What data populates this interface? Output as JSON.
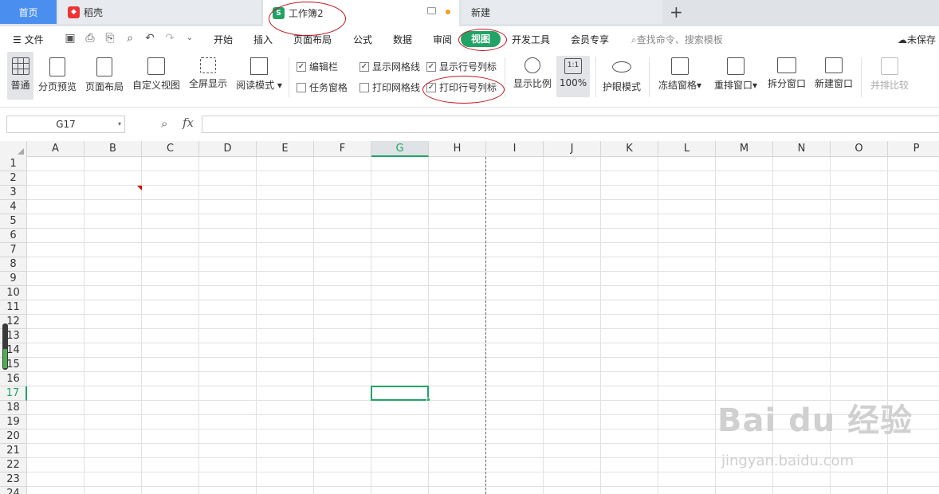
{
  "tabs": {
    "home": "首页",
    "daoke": "稻壳",
    "workbook": "工作簿2",
    "new": "新建"
  },
  "menu": {
    "file": "文件",
    "items": [
      "开始",
      "插入",
      "页面布局",
      "公式",
      "数据",
      "审阅",
      "视图",
      "开发工具",
      "会员专享"
    ],
    "search_placeholder": "查找命令、搜索模板",
    "unsaved": "未保存"
  },
  "ribbon": {
    "normal": "普通",
    "page_break_preview": "分页预览",
    "page_layout": "页面布局",
    "custom_view": "自定义视图",
    "full_screen": "全屏显示",
    "reading_mode": "阅读模式",
    "edit_bar": "编辑栏",
    "task_pane": "任务窗格",
    "show_gridlines": "显示网格线",
    "print_gridlines": "打印网格线",
    "show_row_col_headers": "显示行号列标",
    "print_row_col_headers": "打印行号列标",
    "zoom": "显示比例",
    "zoom_100": "100%",
    "zoom_100_icon": "1:1",
    "eye_protect": "护眼模式",
    "freeze_panes": "冻结窗格",
    "arrange_windows": "重排窗口",
    "split_window": "拆分窗口",
    "new_window": "新建窗口",
    "side_by_side": "并排比较"
  },
  "checks": {
    "edit_bar": true,
    "task_pane": false,
    "show_gridlines": true,
    "print_gridlines": false,
    "show_row_col_headers": true,
    "print_row_col_headers": true
  },
  "formula_bar": {
    "name_box": "G17",
    "fx": "fx",
    "formula": ""
  },
  "grid": {
    "columns": [
      "A",
      "B",
      "C",
      "D",
      "E",
      "F",
      "G",
      "H",
      "I",
      "J",
      "K",
      "L",
      "M",
      "N",
      "O",
      "P"
    ],
    "rows": [
      "1",
      "2",
      "3",
      "4",
      "5",
      "6",
      "7",
      "8",
      "9",
      "10",
      "11",
      "12",
      "13",
      "14",
      "15",
      "16",
      "17",
      "18",
      "19",
      "20",
      "21",
      "22",
      "23",
      "24"
    ],
    "selected_column": "G",
    "selected_row": "17"
  },
  "watermark": {
    "main": "Bai du 经验",
    "sub": "jingyan.baidu.com"
  },
  "colors": {
    "accent": "#21a366",
    "home_tab": "#4a8ff0",
    "annotation": "#c0131b"
  }
}
